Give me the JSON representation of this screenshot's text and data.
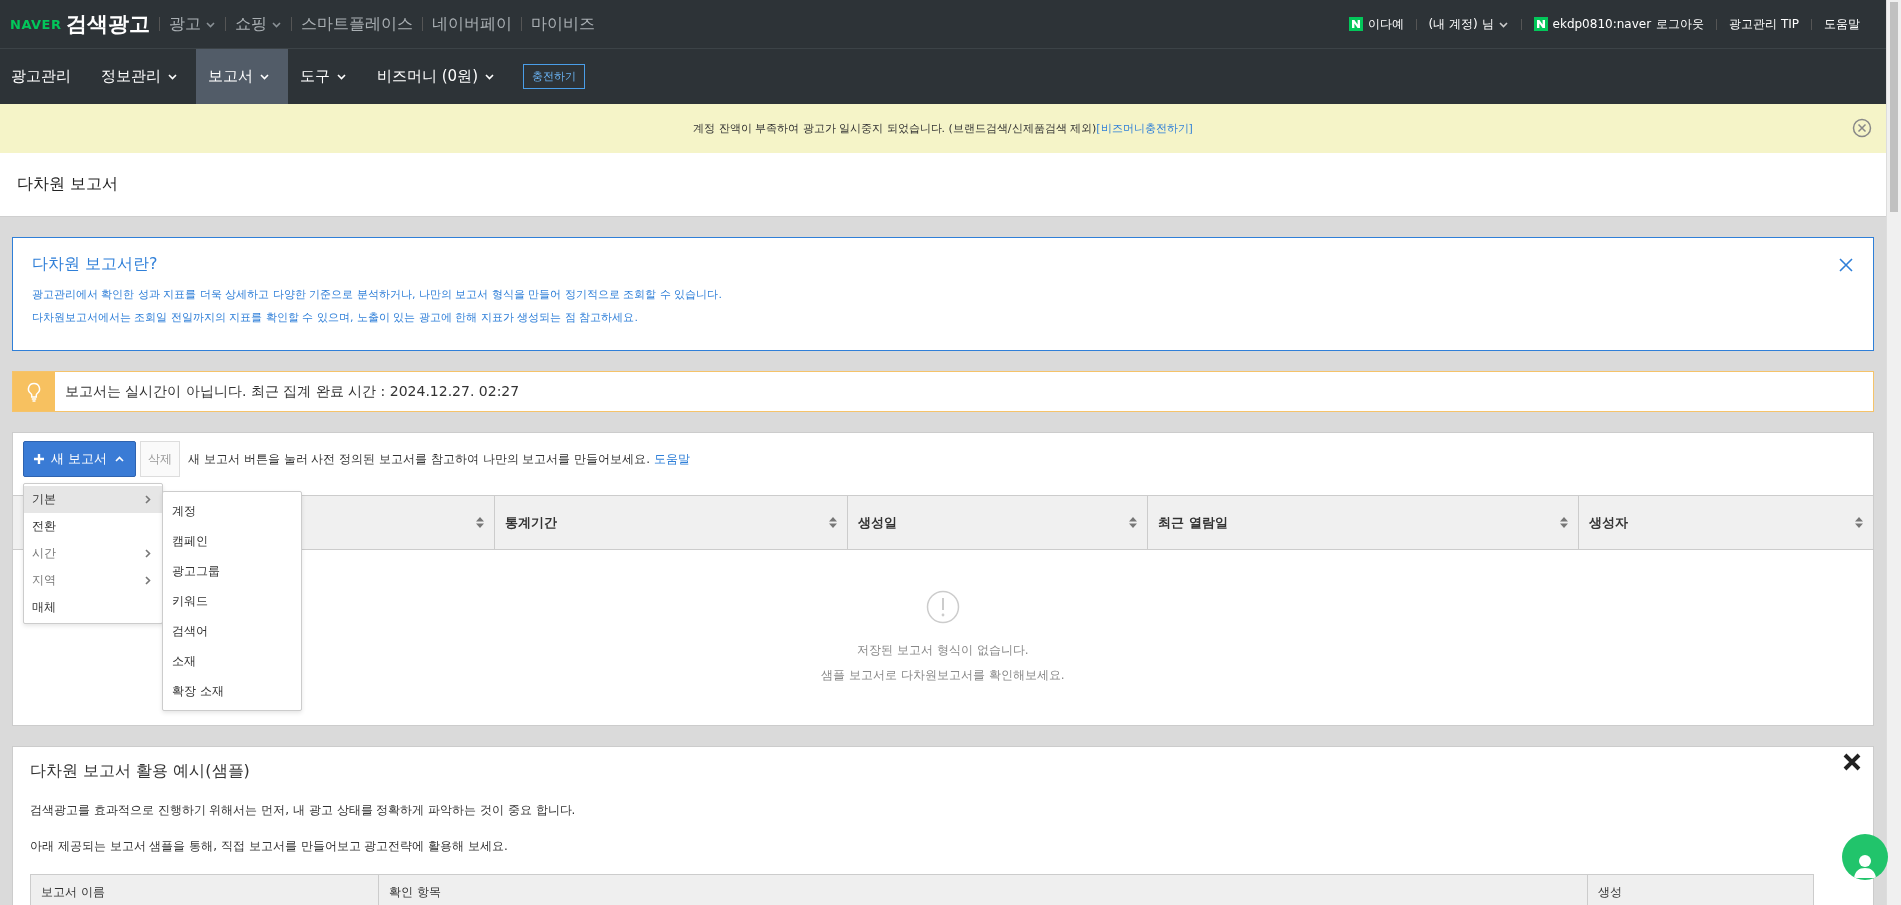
{
  "top_bar": {
    "logo": {
      "brand": "NAVER",
      "product": "검색광고"
    },
    "links": [
      {
        "label": "광고",
        "dropdown": true
      },
      {
        "label": "쇼핑",
        "dropdown": true
      },
      {
        "label": "스마트플레이스",
        "dropdown": false
      },
      {
        "label": "네이버페이",
        "dropdown": false
      },
      {
        "label": "마이비즈",
        "dropdown": false
      }
    ],
    "account": {
      "name": "이다예",
      "suffix": "(내 계정) 님",
      "login_id": "ekdp0810:naver",
      "logout": "로그아웃"
    },
    "right_links": [
      "광고관리 TIP",
      "도움말"
    ]
  },
  "main_nav": {
    "items": [
      {
        "label": "광고관리",
        "dropdown": false,
        "selected": false
      },
      {
        "label": "정보관리",
        "dropdown": true,
        "selected": false
      },
      {
        "label": "보고서",
        "dropdown": true,
        "selected": true
      },
      {
        "label": "도구",
        "dropdown": true,
        "selected": false
      },
      {
        "label": "비즈머니 (0원)",
        "dropdown": true,
        "selected": false
      }
    ],
    "charge_button": "충전하기"
  },
  "alert_banner": {
    "text": "계정 잔액이 부족하여 광고가 일시중지 되었습니다. (브랜드검색/신제품검색 제외)",
    "link": "[비즈머니충전하기]"
  },
  "page_title": "다차원 보고서",
  "info_box": {
    "title": "다차원 보고서란?",
    "lines": [
      "광고관리에서 확인한 성과 지표를 더욱 상세하고 다양한 기준으로 분석하거나, 나만의 보고서 형식을 만들어 정기적으로 조회할 수 있습니다.",
      "다차원보고서에서는 조회일 전일까지의 지표를 확인할 수 있으며, 노출이 있는 광고에 한해 지표가 생성되는 점 참고하세요."
    ]
  },
  "notice": "보고서는 실시간이 아닙니다. 최근 집계 완료 시간 : 2024.12.27. 02:27",
  "reports": {
    "new_button": "새 보고서",
    "delete_button": "삭제",
    "hint": "새 보고서 버튼을 눌러 사전 정의된 보고서를 참고하여 나만의 보고서를 만들어보세요.",
    "help_link": "도움말",
    "menu": [
      {
        "label": "기본",
        "submenu": true,
        "selected": true,
        "disabled": false
      },
      {
        "label": "전환",
        "submenu": false,
        "selected": false,
        "disabled": false
      },
      {
        "label": "시간",
        "submenu": true,
        "selected": false,
        "disabled": true
      },
      {
        "label": "지역",
        "submenu": true,
        "selected": false,
        "disabled": true
      },
      {
        "label": "매체",
        "submenu": false,
        "selected": false,
        "disabled": false
      }
    ],
    "submenu": [
      "계정",
      "캠페인",
      "광고그룹",
      "키워드",
      "검색어",
      "소재",
      "확장 소재"
    ],
    "columns": [
      "통계기간",
      "생성일",
      "최근 열람일",
      "생성자"
    ],
    "empty_lines": [
      "저장된 보고서 형식이 없습니다.",
      "샘플 보고서로 다차원보고서를 확인해보세요."
    ]
  },
  "sample_panel": {
    "title": "다차원 보고서 활용 예시(샘플)",
    "paragraphs": [
      "검색광고를 효과적으로 진행하기 위해서는 먼저, 내 광고 상태를 정확하게 파악하는 것이 중요 합니다.",
      "아래 제공되는 보고서 샘플을 통해, 직접 보고서를 만들어보고 광고전략에 활용해 보세요."
    ],
    "columns": [
      "보고서 이름",
      "확인 항목",
      "생성"
    ]
  }
}
